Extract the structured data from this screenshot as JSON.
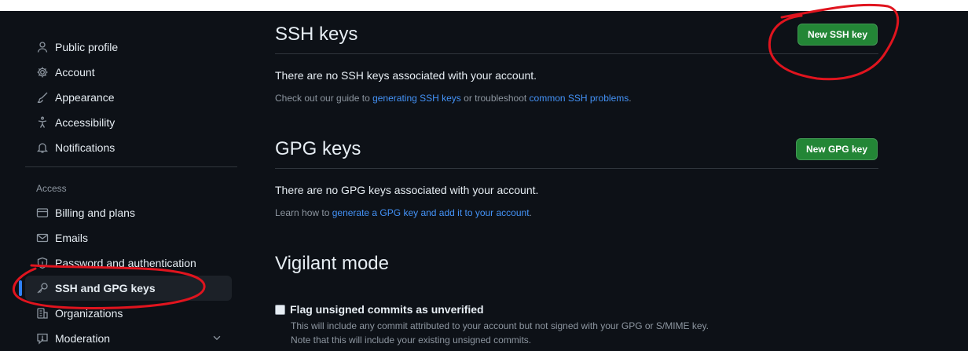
{
  "sidebar": {
    "items_top": [
      {
        "label": "Public profile",
        "icon": "person-icon"
      },
      {
        "label": "Account",
        "icon": "gear-icon"
      },
      {
        "label": "Appearance",
        "icon": "paintbrush-icon"
      },
      {
        "label": "Accessibility",
        "icon": "accessibility-icon"
      },
      {
        "label": "Notifications",
        "icon": "bell-icon"
      }
    ],
    "access_heading": "Access",
    "items_access": [
      {
        "label": "Billing and plans",
        "icon": "credit-card-icon"
      },
      {
        "label": "Emails",
        "icon": "mail-icon"
      },
      {
        "label": "Password and authentication",
        "icon": "shield-icon"
      },
      {
        "label": "SSH and GPG keys",
        "icon": "key-icon",
        "active": true
      },
      {
        "label": "Organizations",
        "icon": "organization-icon"
      },
      {
        "label": "Moderation",
        "icon": "report-icon"
      }
    ]
  },
  "ssh": {
    "title": "SSH keys",
    "button": "New SSH key",
    "empty_message": "There are no SSH keys associated with your account.",
    "guide_prefix": "Check out our guide to ",
    "guide_link": "generating SSH keys",
    "guide_middle": " or troubleshoot ",
    "guide_link2": "common SSH problems",
    "guide_suffix": "."
  },
  "gpg": {
    "title": "GPG keys",
    "button": "New GPG key",
    "empty_message": "There are no GPG keys associated with your account.",
    "learn_prefix": "Learn how to ",
    "learn_link": "generate a GPG key and add it to your account",
    "learn_suffix": "."
  },
  "vigilant": {
    "title": "Vigilant mode",
    "checkbox_label": "Flag unsigned commits as unverified",
    "desc1": "This will include any commit attributed to your account but not signed with your GPG or S/MIME key.",
    "desc2": "Note that this will include your existing unsigned commits."
  },
  "colors": {
    "background": "#0d1117",
    "accent_blue": "#2f81f7",
    "button_green": "#238636",
    "annotation_red": "#e0141e"
  }
}
